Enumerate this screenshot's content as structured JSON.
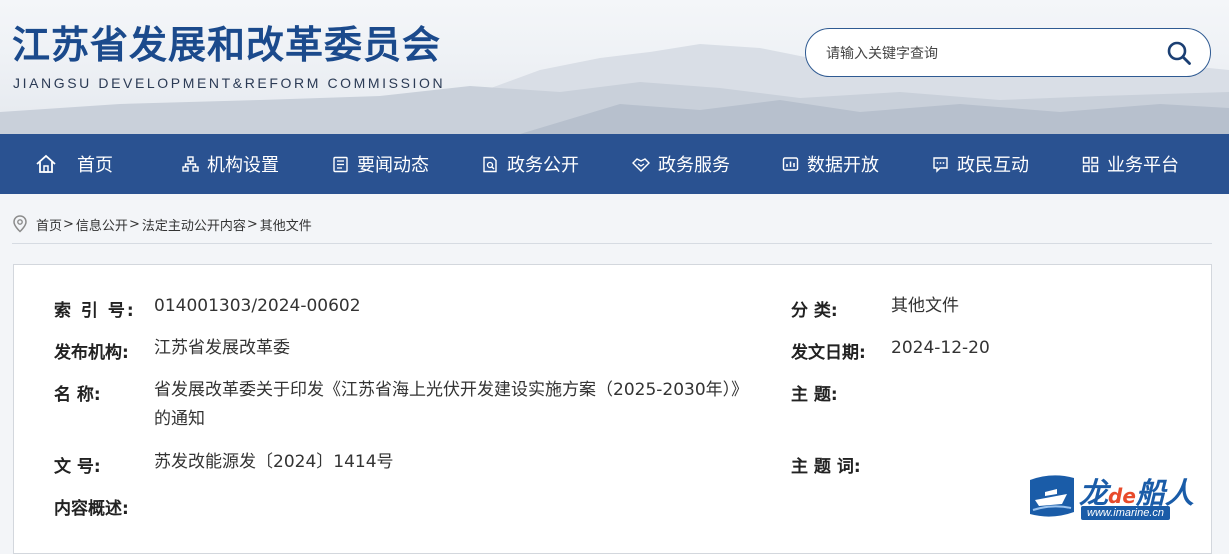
{
  "header": {
    "title": "江苏省发展和改革委员会",
    "subtitle": "JIANGSU DEVELOPMENT&REFORM COMMISSION"
  },
  "search": {
    "placeholder": "请输入关键字查询",
    "icon": "search-icon"
  },
  "nav": {
    "items": [
      {
        "label": "首页",
        "icon": "home-icon"
      },
      {
        "label": "机构设置",
        "icon": "org-chart-icon"
      },
      {
        "label": "要闻动态",
        "icon": "newspaper-icon"
      },
      {
        "label": "政务公开",
        "icon": "document-search-icon"
      },
      {
        "label": "政务服务",
        "icon": "handshake-icon"
      },
      {
        "label": "数据开放",
        "icon": "data-chart-icon"
      },
      {
        "label": "政民互动",
        "icon": "chat-icon"
      },
      {
        "label": "业务平台",
        "icon": "grid-icon"
      }
    ]
  },
  "breadcrumb": {
    "icon": "location-pin-icon",
    "items": [
      "首页",
      "信息公开",
      "法定主动公开内容",
      "其他文件"
    ],
    "separator": ">"
  },
  "info": {
    "index_label": "索  引  号:",
    "index_value": "014001303/2024-00602",
    "category_label": "分      类:",
    "category_value": "其他文件",
    "publisher_label": "发布机构:",
    "publisher_value": "江苏省发展改革委",
    "date_label": "发文日期:",
    "date_value": "2024-12-20",
    "name_label": "名      称:",
    "name_value": "省发展改革委关于印发《江苏省海上光伏开发建设实施方案（2025-2030年）》的通知",
    "topic_label": "主      题:",
    "topic_value": "",
    "docno_label": "文      号:",
    "docno_value": "苏发改能源发〔2024〕1414号",
    "keywords_label": "主 题 词:",
    "keywords_value": "",
    "summary_label": "内容概述:",
    "summary_value": ""
  },
  "watermark": {
    "brand_left": "龙",
    "brand_mid": "de",
    "brand_right": "船人",
    "url": "www.imarine.cn"
  },
  "colors": {
    "brand_blue": "#1b4a8c",
    "nav_blue": "#2a5291",
    "watermark_blue": "#1a5ca8",
    "watermark_red": "#e84b2b"
  }
}
